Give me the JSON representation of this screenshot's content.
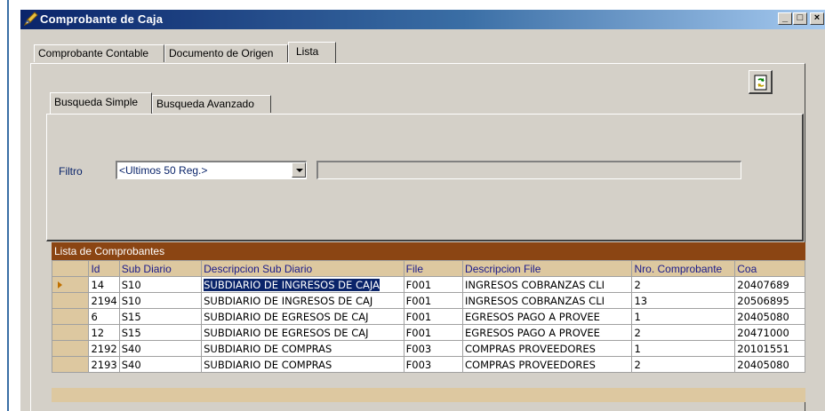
{
  "window": {
    "title": "Comprobante de Caja",
    "buttons": {
      "minimize": "_",
      "maximize": "□",
      "close": "×"
    }
  },
  "outer_tabs": [
    "Comprobante Contable",
    "Documento de Origen",
    "Lista"
  ],
  "inner_tabs": [
    "Busqueda Simple",
    "Busqueda Avanzado"
  ],
  "filter": {
    "label": "Filtro",
    "selected": "<Ultimos 50 Reg.>",
    "text_value": ""
  },
  "grid": {
    "caption": "Lista de Comprobantes",
    "columns": [
      "Id",
      "Sub Diario",
      "Descripcion Sub Diario",
      "File",
      "Descripcion File",
      "Nro. Comprobante",
      "Coa"
    ],
    "rows": [
      [
        "14",
        "S10",
        "SUBDIARIO DE INGRESOS DE CAJA",
        "F001",
        "INGRESOS COBRANZAS CLI",
        "2",
        "20407689"
      ],
      [
        "2194",
        "S10",
        "SUBDIARIO DE INGRESOS DE CAJ",
        "F001",
        "INGRESOS COBRANZAS CLI",
        "13",
        "20506895"
      ],
      [
        "6",
        "S15",
        "SUBDIARIO DE EGRESOS DE CAJ",
        "F001",
        "EGRESOS PAGO A PROVEE",
        "1",
        "20405080"
      ],
      [
        "12",
        "S15",
        "SUBDIARIO DE EGRESOS DE CAJ",
        "F001",
        "EGRESOS PAGO A PROVEE",
        "2",
        "20471000"
      ],
      [
        "2192",
        "S40",
        "SUBDIARIO DE COMPRAS",
        "F003",
        "COMPRAS PROVEEDORES",
        "1",
        "20101551"
      ],
      [
        "2193",
        "S40",
        "SUBDIARIO DE COMPRAS",
        "F003",
        "COMPRAS PROVEEDORES",
        "2",
        "20405080"
      ]
    ],
    "selected_row": 0
  },
  "icons": {
    "app": "pen-icon",
    "refresh": "refresh-icon",
    "row_pointer": "row-pointer-icon"
  },
  "colors": {
    "titlebar_start": "#0a246a",
    "grid_caption": "#8b4513",
    "grid_header": "#ddc8a0",
    "selection": "#0a246a"
  }
}
